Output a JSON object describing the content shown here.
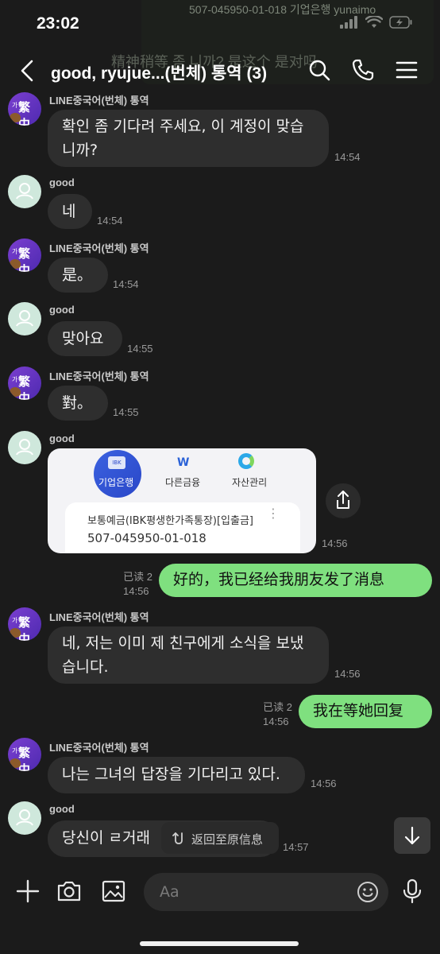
{
  "status": {
    "time": "23:02"
  },
  "ghost_notification": {
    "line1": "507-045950-01-018 기업은행 yunaimo",
    "line2": "精神稍等 좀 니까? 是这个 是对吗"
  },
  "header": {
    "title": "good, ryujue...(번체) 통역 (3)"
  },
  "messages": {
    "m1": {
      "sender": "LINE중국어(번체) 통역",
      "text_line1": "확인 좀 기다려 주세요, 이 계정이 맞습",
      "text_line2": "니까?",
      "time": "14:54"
    },
    "m2": {
      "sender": "good",
      "text": "네",
      "time": "14:54"
    },
    "m3": {
      "sender": "LINE중국어(번체) 통역",
      "text": "是。",
      "time": "14:54"
    },
    "m4": {
      "sender": "good",
      "text": "맞아요",
      "time": "14:55"
    },
    "m5": {
      "sender": "LINE중국어(번체) 통역",
      "text": "對。",
      "time": "14:55"
    },
    "m6": {
      "sender": "good",
      "image": {
        "tab1": "기업은행",
        "tab1_logo": "IBK",
        "tab2": "다른금융",
        "tab2_icon": "W",
        "tab3": "자산관리",
        "account_type": "보통예금(IBK평생한가족통장)[입출금]",
        "account_number": "507-045950-01-018",
        "menu": "⋮"
      },
      "time": "14:56"
    },
    "m7": {
      "text": "好的，我已经给我朋友发了消息",
      "read": "已读 2",
      "time": "14:56"
    },
    "m8": {
      "sender": "LINE중국어(번체) 통역",
      "text_line1": "네, 저는 이미 제 친구에게 소식을 보냈",
      "text_line2": "습니다.",
      "time": "14:56"
    },
    "m9": {
      "text": "我在等她回复",
      "read": "已读 2",
      "time": "14:56"
    },
    "m10": {
      "sender": "LINE중국어(번체) 통역",
      "text": "나는 그녀의 답장을 기다리고 있다.",
      "time": "14:56"
    },
    "m11": {
      "sender": "good",
      "text": "당신이 ㄹ거래",
      "time": "14:57"
    }
  },
  "avatar_line": {
    "small": "가",
    "big": "繁中"
  },
  "revert_chip": {
    "label": "返回至原信息"
  },
  "input": {
    "placeholder": "Aa"
  },
  "colors": {
    "my_bubble": "#7fe07f",
    "their_bubble": "#2e2e2e",
    "background": "#1b1b1b"
  }
}
